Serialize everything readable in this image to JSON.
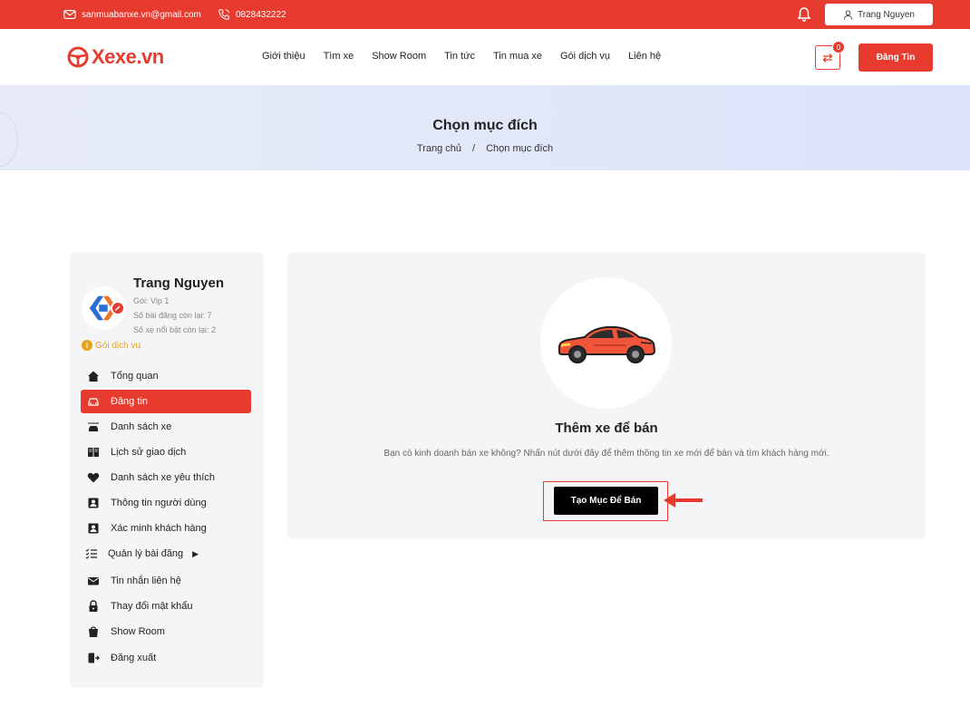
{
  "topbar": {
    "email": "sanmuabanxe.vn@gmail.com",
    "phone": "0828432222",
    "user_name": "Trang Nguyen"
  },
  "header": {
    "logo_text": "Xexe.vn",
    "nav": [
      "Giới thiệu",
      "Tìm xe",
      "Show Room",
      "Tin tức",
      "Tin mua xe",
      "Gói dịch vụ",
      "Liên hệ"
    ],
    "swap_count": "0",
    "post_button": "Đăng Tin"
  },
  "banner": {
    "title": "Chọn mục đích",
    "breadcrumb_home": "Trang chủ",
    "breadcrumb_sep": "/",
    "breadcrumb_current": "Chọn mục đích"
  },
  "sidebar": {
    "name": "Trang Nguyen",
    "package": "Gói: Vip 1",
    "posts_left": "Số bài đăng còn lại: 7",
    "featured_left": "Số xe nổi bật còn lại: 2",
    "package_link": "Gói dịch vụ",
    "menu": [
      {
        "label": "Tổng quan",
        "icon": "home-icon"
      },
      {
        "label": "Đăng tin",
        "icon": "car-icon"
      },
      {
        "label": "Danh sách xe",
        "icon": "car-list-icon"
      },
      {
        "label": "Lịch sử giao dịch",
        "icon": "history-icon"
      },
      {
        "label": "Danh sách xe yêu thích",
        "icon": "heart-icon"
      },
      {
        "label": "Thông tin người dùng",
        "icon": "user-card-icon"
      },
      {
        "label": "Xác minh khách hàng",
        "icon": "verify-icon"
      },
      {
        "label": "Quản lý bài đăng",
        "icon": "checklist-icon"
      },
      {
        "label": "Tin nhắn liên hệ",
        "icon": "mail-icon"
      },
      {
        "label": "Thay đổi mật khẩu",
        "icon": "lock-icon"
      },
      {
        "label": "Show Room",
        "icon": "showroom-icon"
      },
      {
        "label": "Đăng xuất",
        "icon": "logout-icon"
      }
    ]
  },
  "main": {
    "title": "Thêm xe để bán",
    "description": "Bạn có kinh doanh bán xe không? Nhấn nút dưới đây để thêm thông tin xe mới để bán và tìm khách hàng mới.",
    "create_button": "Tạo Mục Để Bán"
  },
  "colors": {
    "brand": "#e63b2e",
    "accent": "#e7a21b"
  }
}
